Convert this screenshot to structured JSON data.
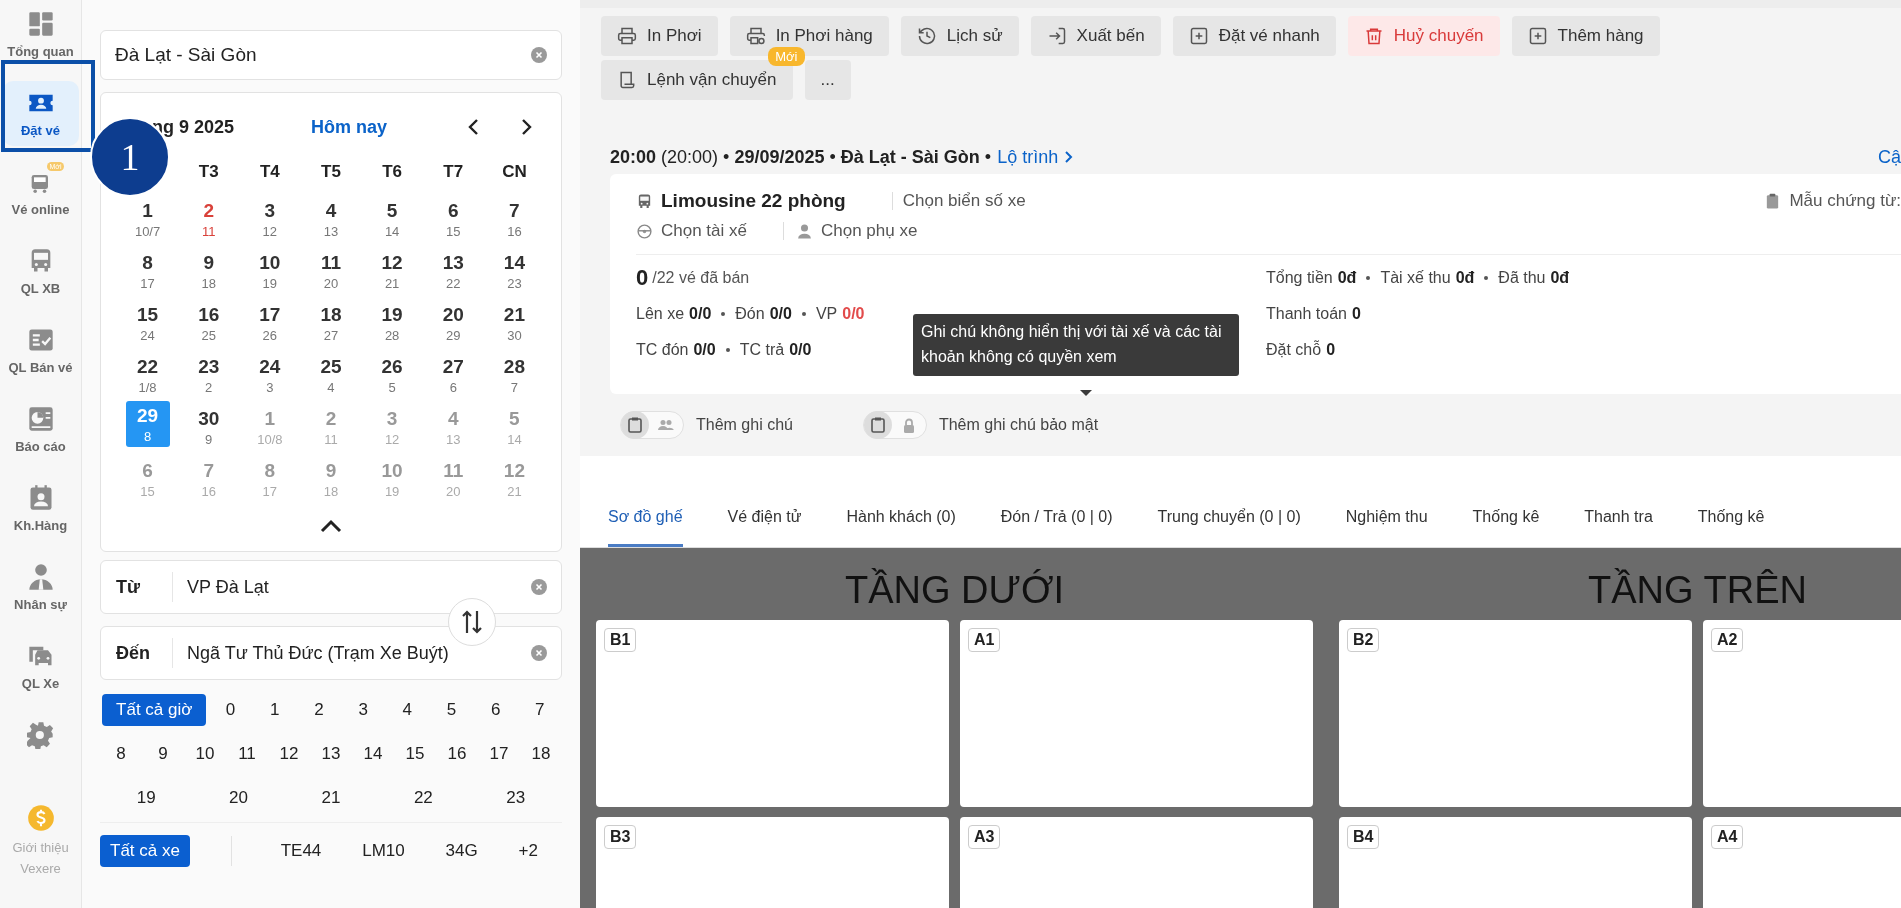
{
  "annotation": {
    "step": "1"
  },
  "sidebar": {
    "items": [
      {
        "label": "Tổng quan",
        "selected": false
      },
      {
        "label": "Đặt vé",
        "selected": true
      },
      {
        "label": "Vé online",
        "selected": false,
        "badge": "Mới"
      },
      {
        "label": "QL XB",
        "selected": false
      },
      {
        "label": "QL Bán vé",
        "selected": false
      },
      {
        "label": "Báo cáo",
        "selected": false
      },
      {
        "label": "Kh.Hàng",
        "selected": false
      },
      {
        "label": "Nhân sự",
        "selected": false
      },
      {
        "label": "QL Xe",
        "selected": false
      },
      {
        "selected": false
      },
      {
        "label": "Giới thiệu Vexere",
        "selected": false
      }
    ]
  },
  "route_field": {
    "value": "Đà Lạt - Sài Gòn"
  },
  "calendar": {
    "month": "ng 9 2025",
    "today_link": "Hôm nay",
    "weekdays": [
      "T3",
      "T4",
      "T5",
      "T6",
      "T7",
      "CN"
    ],
    "days": [
      {
        "day": "1",
        "lunar": "10/7",
        "selected": false,
        "other_month": false,
        "holiday": false
      },
      {
        "day": "2",
        "lunar": "11",
        "selected": false,
        "other_month": false,
        "holiday": true
      },
      {
        "day": "3",
        "lunar": "12",
        "selected": false,
        "other_month": false,
        "holiday": false
      },
      {
        "day": "4",
        "lunar": "13",
        "selected": false,
        "other_month": false,
        "holiday": false
      },
      {
        "day": "5",
        "lunar": "14",
        "selected": false,
        "other_month": false,
        "holiday": false
      },
      {
        "day": "6",
        "lunar": "15",
        "selected": false,
        "other_month": false,
        "holiday": false
      },
      {
        "day": "7",
        "lunar": "16",
        "selected": false,
        "other_month": false,
        "holiday": false
      },
      {
        "day": "8",
        "lunar": "17",
        "selected": false,
        "other_month": false,
        "holiday": false
      },
      {
        "day": "9",
        "lunar": "18",
        "selected": false,
        "other_month": false,
        "holiday": false
      },
      {
        "day": "10",
        "lunar": "19",
        "selected": false,
        "other_month": false,
        "holiday": false
      },
      {
        "day": "11",
        "lunar": "20",
        "selected": false,
        "other_month": false,
        "holiday": false
      },
      {
        "day": "12",
        "lunar": "21",
        "selected": false,
        "other_month": false,
        "holiday": false
      },
      {
        "day": "13",
        "lunar": "22",
        "selected": false,
        "other_month": false,
        "holiday": false
      },
      {
        "day": "14",
        "lunar": "23",
        "selected": false,
        "other_month": false,
        "holiday": false
      },
      {
        "day": "15",
        "lunar": "24",
        "selected": false,
        "other_month": false,
        "holiday": false
      },
      {
        "day": "16",
        "lunar": "25",
        "selected": false,
        "other_month": false,
        "holiday": false
      },
      {
        "day": "17",
        "lunar": "26",
        "selected": false,
        "other_month": false,
        "holiday": false
      },
      {
        "day": "18",
        "lunar": "27",
        "selected": false,
        "other_month": false,
        "holiday": false
      },
      {
        "day": "19",
        "lunar": "28",
        "selected": false,
        "other_month": false,
        "holiday": false
      },
      {
        "day": "20",
        "lunar": "29",
        "selected": false,
        "other_month": false,
        "holiday": false
      },
      {
        "day": "21",
        "lunar": "30",
        "selected": false,
        "other_month": false,
        "holiday": false
      },
      {
        "day": "22",
        "lunar": "1/8",
        "selected": false,
        "other_month": false,
        "holiday": false
      },
      {
        "day": "23",
        "lunar": "2",
        "selected": false,
        "other_month": false,
        "holiday": false
      },
      {
        "day": "24",
        "lunar": "3",
        "selected": false,
        "other_month": false,
        "holiday": false
      },
      {
        "day": "25",
        "lunar": "4",
        "selected": false,
        "other_month": false,
        "holiday": false
      },
      {
        "day": "26",
        "lunar": "5",
        "selected": false,
        "other_month": false,
        "holiday": false
      },
      {
        "day": "27",
        "lunar": "6",
        "selected": false,
        "other_month": false,
        "holiday": false
      },
      {
        "day": "28",
        "lunar": "7",
        "selected": false,
        "other_month": false,
        "holiday": false
      },
      {
        "day": "29",
        "lunar": "8",
        "selected": true,
        "other_month": false,
        "holiday": false
      },
      {
        "day": "30",
        "lunar": "9",
        "selected": false,
        "other_month": false,
        "holiday": false
      },
      {
        "day": "1",
        "lunar": "10/8",
        "selected": false,
        "other_month": true,
        "holiday": false
      },
      {
        "day": "2",
        "lunar": "11",
        "selected": false,
        "other_month": true,
        "holiday": false
      },
      {
        "day": "3",
        "lunar": "12",
        "selected": false,
        "other_month": true,
        "holiday": false
      },
      {
        "day": "4",
        "lunar": "13",
        "selected": false,
        "other_month": true,
        "holiday": false
      },
      {
        "day": "5",
        "lunar": "14",
        "selected": false,
        "other_month": true,
        "holiday": false
      },
      {
        "day": "6",
        "lunar": "15",
        "selected": false,
        "other_month": true,
        "holiday": false
      },
      {
        "day": "7",
        "lunar": "16",
        "selected": false,
        "other_month": true,
        "holiday": false
      },
      {
        "day": "8",
        "lunar": "17",
        "selected": false,
        "other_month": true,
        "holiday": false
      },
      {
        "day": "9",
        "lunar": "18",
        "selected": false,
        "other_month": true,
        "holiday": false
      },
      {
        "day": "10",
        "lunar": "19",
        "selected": false,
        "other_month": true,
        "holiday": false
      },
      {
        "day": "11",
        "lunar": "20",
        "selected": false,
        "other_month": true,
        "holiday": false
      },
      {
        "day": "12",
        "lunar": "21",
        "selected": false,
        "other_month": true,
        "holiday": false
      }
    ]
  },
  "from_field": {
    "label": "Từ",
    "value": "VP Đà Lạt"
  },
  "to_field": {
    "label": "Đến",
    "value": "Ngã Tư Thủ Đức (Trạm Xe Buýt)"
  },
  "hours": [
    {
      "label": "Tất cả giờ",
      "selected": true
    },
    {
      "label": "0",
      "selected": false
    },
    {
      "label": "1",
      "selected": false
    },
    {
      "label": "2",
      "selected": false
    },
    {
      "label": "3",
      "selected": false
    },
    {
      "label": "4",
      "selected": false
    },
    {
      "label": "5",
      "selected": false
    },
    {
      "label": "6",
      "selected": false
    },
    {
      "label": "7",
      "selected": false
    },
    {
      "label": "8",
      "selected": false
    },
    {
      "label": "9",
      "selected": false
    },
    {
      "label": "10",
      "selected": false
    },
    {
      "label": "11",
      "selected": false
    },
    {
      "label": "12",
      "selected": false
    },
    {
      "label": "13",
      "selected": false
    },
    {
      "label": "14",
      "selected": false
    },
    {
      "label": "15",
      "selected": false
    },
    {
      "label": "16",
      "selected": false
    },
    {
      "label": "17",
      "selected": false
    },
    {
      "label": "18",
      "selected": false
    },
    {
      "label": "19",
      "selected": false
    },
    {
      "label": "20",
      "selected": false
    },
    {
      "label": "21",
      "selected": false
    },
    {
      "label": "22",
      "selected": false
    },
    {
      "label": "23",
      "selected": false
    }
  ],
  "vehicles": [
    {
      "label": "Tất cả xe",
      "selected": true
    },
    {
      "label": "TE44",
      "selected": false
    },
    {
      "label": "LM10",
      "selected": false
    },
    {
      "label": "34G",
      "selected": false
    },
    {
      "label": "+2",
      "selected": false
    }
  ],
  "toolbar": {
    "buttons": [
      {
        "label": "In Phơi",
        "danger": false
      },
      {
        "label": "In Phơi hàng",
        "danger": false
      },
      {
        "label": "Lịch sử",
        "danger": false
      },
      {
        "label": "Xuất bến",
        "danger": false
      },
      {
        "label": "Đặt vé nhanh",
        "danger": false
      },
      {
        "label": "Huỷ chuyến",
        "danger": true
      },
      {
        "label": "Thêm hàng",
        "danger": false
      },
      {
        "label": "Lệnh vận chuyển",
        "danger": false,
        "badge": "Mới"
      },
      {
        "label": "...",
        "danger": false
      }
    ]
  },
  "trip": {
    "header": "**20:00** (20:00) • **29/09/2025** • **Đà Lạt - Sài Gòn** •",
    "route_link": "Lộ trình",
    "update_link": "Cậ",
    "vehicle": "Limousine 22 phòng",
    "plate": "Chọn biển số xe",
    "driver": "Chọn tài xế",
    "assistant": "Chọn phụ xe",
    "document_template": "Mẫu chứng từ:",
    "sold": "0",
    "sold_suffix": "/22 vé đã bán",
    "left_stats": [
      [
        {
          "label": "Lên xe",
          "value": "0/0",
          "alert": false
        },
        {
          "label": "Đón",
          "value": "0/0",
          "alert": false
        },
        {
          "label": "VP",
          "value": "0/0",
          "alert": true
        }
      ],
      [
        {
          "label": "TC đón",
          "value": "0/0",
          "alert": false
        },
        {
          "label": "TC trả",
          "value": "0/0",
          "alert": false
        }
      ]
    ],
    "right_stats": [
      [
        {
          "label": "Tổng tiền",
          "value": "0đ",
          "alert": false
        },
        {
          "label": "Tài xế thu",
          "value": "0đ",
          "alert": false
        },
        {
          "label": "Đã thu",
          "value": "0đ",
          "alert": false
        }
      ],
      [
        {
          "label": "Thanh toán",
          "value": "0",
          "alert": false
        }
      ],
      [
        {
          "label": "Đặt chỗ",
          "value": "0",
          "alert": false
        }
      ]
    ]
  },
  "tooltip": {
    "text": "Ghi chú không hiển thị với tài xế và các tài khoản không có quyền xem"
  },
  "notes": [
    {
      "label": "Thêm ghi chú",
      "kind": "shared"
    },
    {
      "label": "Thêm ghi chú bảo mật",
      "kind": "private"
    }
  ],
  "tabs": [
    {
      "label": "Sơ đồ ghế",
      "selected": true
    },
    {
      "label": "Vé điện tử",
      "selected": false
    },
    {
      "label": "Hành khách (0)",
      "selected": false
    },
    {
      "label": "Đón / Trả (0 | 0)",
      "selected": false
    },
    {
      "label": "Trung chuyển (0 | 0)",
      "selected": false
    },
    {
      "label": "Nghiệm thu",
      "selected": false
    },
    {
      "label": "Thống kê",
      "selected": false
    },
    {
      "label": "Thanh tra",
      "selected": false
    },
    {
      "label": "Thống kê",
      "selected": false
    }
  ],
  "floors": [
    {
      "title": "TẦNG DƯỚI",
      "seats": [
        "B1",
        "A1",
        "B3",
        "A3"
      ]
    },
    {
      "title": "TẦNG TRÊN",
      "seats": [
        "B2",
        "A2",
        "B4",
        "A4"
      ]
    }
  ]
}
